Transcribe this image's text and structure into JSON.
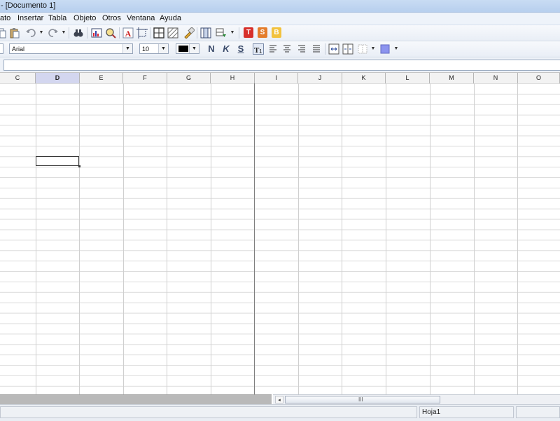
{
  "window": {
    "title": "- [Documento 1]"
  },
  "menu": [
    "ato",
    "Insertar",
    "Tabla",
    "Objeto",
    "Otros",
    "Ventana",
    "Ayuda"
  ],
  "format_toolbar": {
    "font_name": "Arial",
    "font_size": "10",
    "bold_glyph": "N",
    "italic_glyph": "K",
    "underline_glyph": "S"
  },
  "toolbar_badges": [
    "T",
    "S",
    "B"
  ],
  "columns": [
    "C",
    "D",
    "E",
    "F",
    "G",
    "H",
    "I",
    "J",
    "K",
    "L",
    "M",
    "N",
    "O"
  ],
  "active_column": "D",
  "status": {
    "sheet_name": "Hoja1"
  },
  "scrollbar": {
    "grip": "III"
  },
  "colors": {
    "titlebar": "#c9dcf3",
    "badge_t": "#d7302b",
    "badge_s": "#e47d2c",
    "badge_b": "#f2c23e",
    "font_color": "#000000",
    "fill_color": "#8c94ef"
  }
}
